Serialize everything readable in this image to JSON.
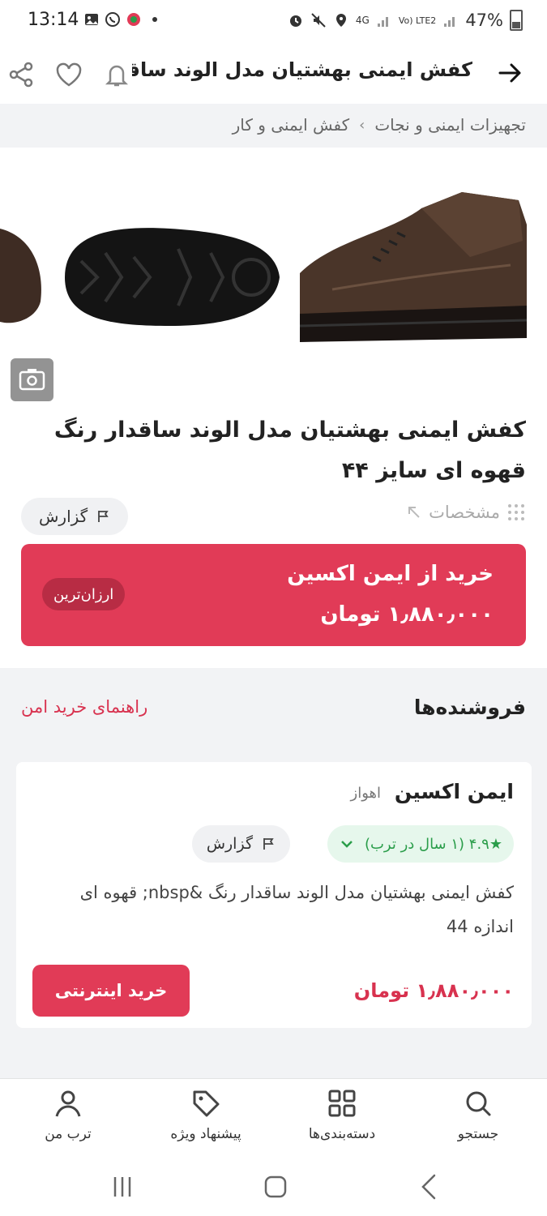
{
  "status_bar": {
    "time": "13:14",
    "network_label": "4G",
    "volte_label": "Vo) LTE2",
    "battery": "47%"
  },
  "app_bar": {
    "title": "کفش ایمنی بهشتیان مدل الوند ساقد...",
    "icons": [
      "back-arrow-icon",
      "bell-icon",
      "heart-icon",
      "share-icon"
    ]
  },
  "breadcrumb": {
    "items": [
      "تجهیزات ایمنی و نجات",
      "کفش ایمنی و کار"
    ],
    "separator": "›"
  },
  "product": {
    "title": "کفش ایمنی بهشتیان مدل الوند ساقدار رنگ قهوه ای سایز ۴۴",
    "specs_label": "مشخصات",
    "report_label": "گزارش"
  },
  "buy_banner": {
    "line1": "خرید از ایمن اکسین",
    "price": "۱٫۸۸۰٫۰۰۰ تومان",
    "badge": "ارزان‌ترین",
    "color": "#e13b57"
  },
  "sellers": {
    "title": "فروشنده‌ها",
    "safe_guide": "راهنمای خرید امن",
    "card": {
      "name": "ایمن اکسین",
      "city": "اهواز",
      "rating": "★۴.۹ (۱ سال در ترب)",
      "report_label": "گزارش",
      "description": "کفش ایمنی بهشتیان مدل الوند ساقدار رنگ &nbsp; قهوه ای اندازه 44",
      "price": "۱٫۸۸۰٫۰۰۰ تومان",
      "buy_button": "خرید اینترنتی"
    }
  },
  "bottom_nav": {
    "items": [
      {
        "label": "جستجو",
        "icon": "search-icon"
      },
      {
        "label": "دسته‌بندی‌ها",
        "icon": "grid-icon"
      },
      {
        "label": "پیشنهاد ویژه",
        "icon": "tag-icon"
      },
      {
        "label": "ترب من",
        "icon": "user-icon"
      }
    ]
  },
  "colors": {
    "accent": "#e13b57",
    "accent_text": "#d8324f",
    "rating_green": "#2a9d4a"
  }
}
